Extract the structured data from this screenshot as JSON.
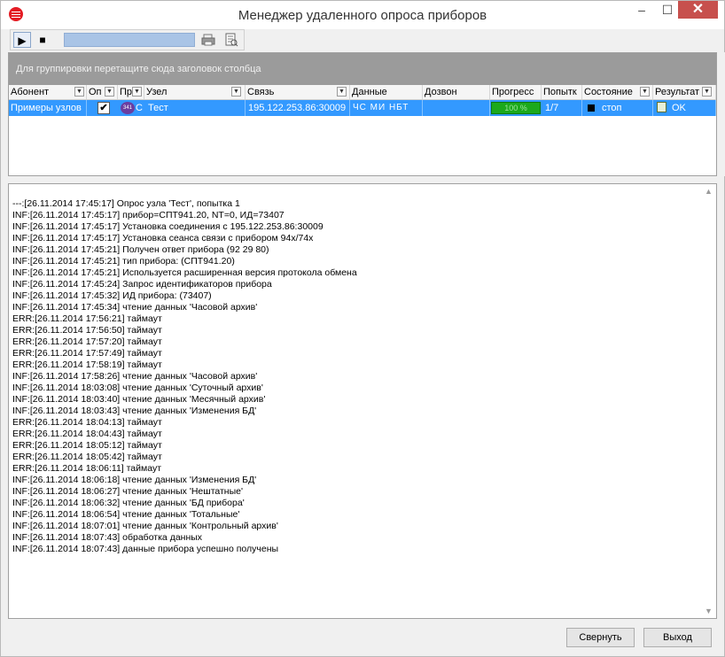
{
  "window": {
    "title": "Менеджер удаленного опроса приборов",
    "minimize_label": "–",
    "maximize_label": "☐",
    "close_label": "✕"
  },
  "toolbar": {
    "play_label": "▶",
    "stop_label": "■"
  },
  "grid": {
    "group_hint": "Для группировки перетащите сюда заголовок столбца",
    "columns": [
      "Абонент",
      "Оп",
      "Пр",
      "Узел",
      "Связь",
      "Данные",
      "Дозвон",
      "Прогресс",
      "Попытк",
      "Состояние",
      "Результат"
    ],
    "dropdown_glyph": "▼",
    "row": {
      "subscriber": "Примеры узлов",
      "checked": "✔",
      "device_badge": "341",
      "device_badge_extra": "С",
      "node": "Тест",
      "connection": "195.122.253.86:30009",
      "data": "ЧС МИ НБТ",
      "dial": "",
      "progress_label": "100 %",
      "progress_value": 1.0,
      "attempts": "1/7",
      "state": "стоп",
      "result": "OK"
    }
  },
  "log": {
    "lines": [
      "---:[26.11.2014 17:45:17] Опрос узла 'Тест', попытка 1",
      "INF:[26.11.2014 17:45:17] прибор=СПТ941.20, NT=0, ИД=73407",
      "INF:[26.11.2014 17:45:17] Установка соединения с 195.122.253.86:30009",
      "INF:[26.11.2014 17:45:17] Установка сеанса связи с прибором 94x/74x",
      "INF:[26.11.2014 17:45:21] Получен ответ прибора (92 29 80)",
      "INF:[26.11.2014 17:45:21] тип прибора: (СПТ941.20)",
      "INF:[26.11.2014 17:45:21] Используется расширенная версия протокола обмена",
      "INF:[26.11.2014 17:45:24] Запрос идентификаторов прибора",
      "INF:[26.11.2014 17:45:32] ИД прибора: (73407)",
      "INF:[26.11.2014 17:45:34] чтение данных 'Часовой архив'",
      "ERR:[26.11.2014 17:56:21] таймаут",
      "ERR:[26.11.2014 17:56:50] таймаут",
      "ERR:[26.11.2014 17:57:20] таймаут",
      "ERR:[26.11.2014 17:57:49] таймаут",
      "ERR:[26.11.2014 17:58:19] таймаут",
      "INF:[26.11.2014 17:58:26] чтение данных 'Часовой архив'",
      "INF:[26.11.2014 18:03:08] чтение данных 'Суточный архив'",
      "INF:[26.11.2014 18:03:40] чтение данных 'Месячный архив'",
      "INF:[26.11.2014 18:03:43] чтение данных 'Изменения БД'",
      "ERR:[26.11.2014 18:04:13] таймаут",
      "ERR:[26.11.2014 18:04:43] таймаут",
      "ERR:[26.11.2014 18:05:12] таймаут",
      "ERR:[26.11.2014 18:05:42] таймаут",
      "ERR:[26.11.2014 18:06:11] таймаут",
      "INF:[26.11.2014 18:06:18] чтение данных 'Изменения БД'",
      "INF:[26.11.2014 18:06:27] чтение данных 'Нештатные'",
      "INF:[26.11.2014 18:06:32] чтение данных 'БД прибора'",
      "INF:[26.11.2014 18:06:54] чтение данных 'Тотальные'",
      "INF:[26.11.2014 18:07:01] чтение данных 'Контрольный архив'",
      "INF:[26.11.2014 18:07:43] обработка данных",
      "INF:[26.11.2014 18:07:43] данные прибора успешно получены"
    ],
    "scroll_up": "▲",
    "scroll_down": "▼"
  },
  "footer": {
    "collapse_label": "Свернуть",
    "exit_label": "Выход"
  }
}
